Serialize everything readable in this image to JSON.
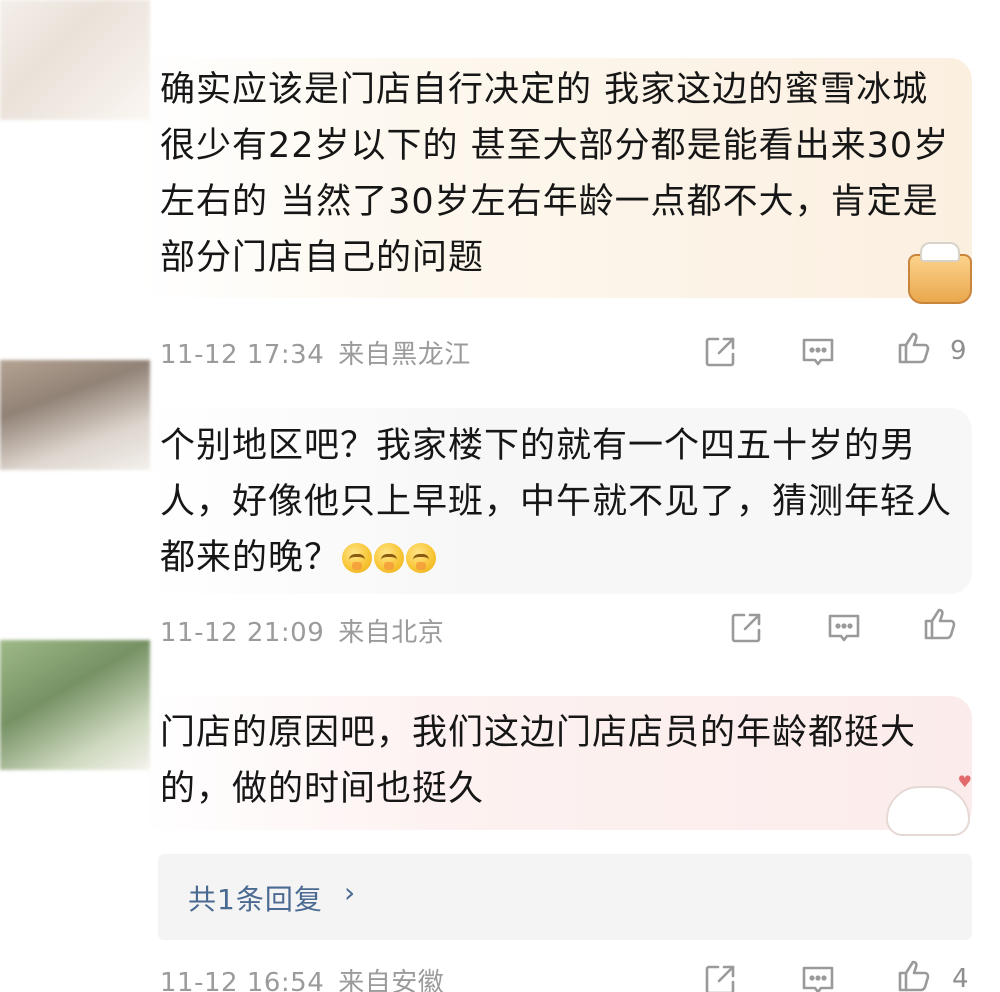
{
  "comments": [
    {
      "text": "确实应该是门店自行决定的  我家这边的蜜雪冰城很少有22岁以下的 甚至大部分都是能看出来30岁左右的  当然了30岁左右年龄一点都不大，肯定是部分门店自己的问题",
      "time": "11-12 17:34",
      "location": "来自黑龙江",
      "likes": "9"
    },
    {
      "text": "个别地区吧？我家楼下的就有一个四五十岁的男人，好像他只上早班，中午就不见了，猜测年轻人都来的晚？",
      "emojis": [
        "shush-emoji",
        "shush-emoji",
        "shush-emoji"
      ],
      "time": "11-12 21:09",
      "location": "来自北京",
      "likes": ""
    },
    {
      "text": "门店的原因吧，我们这边门店店员的年龄都挺大的，做的时间也挺久",
      "time": "11-12 16:54",
      "location": "来自安徽",
      "likes": "4",
      "replies_label": "共1条回复",
      "replies_chevron": "›"
    }
  ],
  "icons": {
    "share": "share-icon",
    "comment": "comment-icon",
    "like": "thumbs-up-icon"
  },
  "colors": {
    "meta_gray": "#9b9b9b",
    "reply_link": "#4a6a92",
    "reply_bg": "#f4f4f4"
  }
}
